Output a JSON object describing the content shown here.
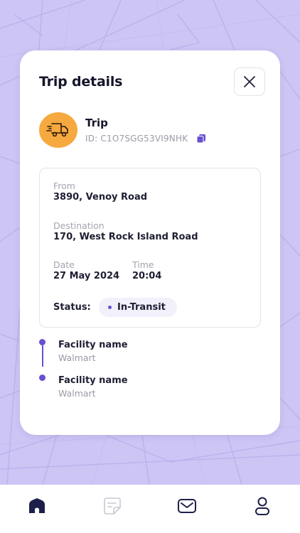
{
  "card": {
    "title": "Trip details"
  },
  "trip": {
    "label": "Trip",
    "id_text": "ID: C1O7SGG53VI9NHK"
  },
  "details": {
    "from_label": "From",
    "from_value": "3890, Venoy Road",
    "destination_label": "Destination",
    "destination_value": "170, West Rock Island Road",
    "date_label": "Date",
    "date_value": "27 May 2024",
    "time_label": "Time",
    "time_value": "20:04",
    "status_label": "Status:",
    "status_value": "In-Transit"
  },
  "timeline": [
    {
      "name": "Facility name",
      "value": "Walmart"
    },
    {
      "name": "Facility name",
      "value": "Walmart"
    }
  ],
  "nav": {
    "items": [
      "home-icon",
      "document-icon",
      "mail-icon",
      "user-icon"
    ]
  },
  "colors": {
    "accent": "#6a4fd1",
    "trip_icon_bg": "#f6a93f",
    "map_bg": "#cdc5f4"
  }
}
